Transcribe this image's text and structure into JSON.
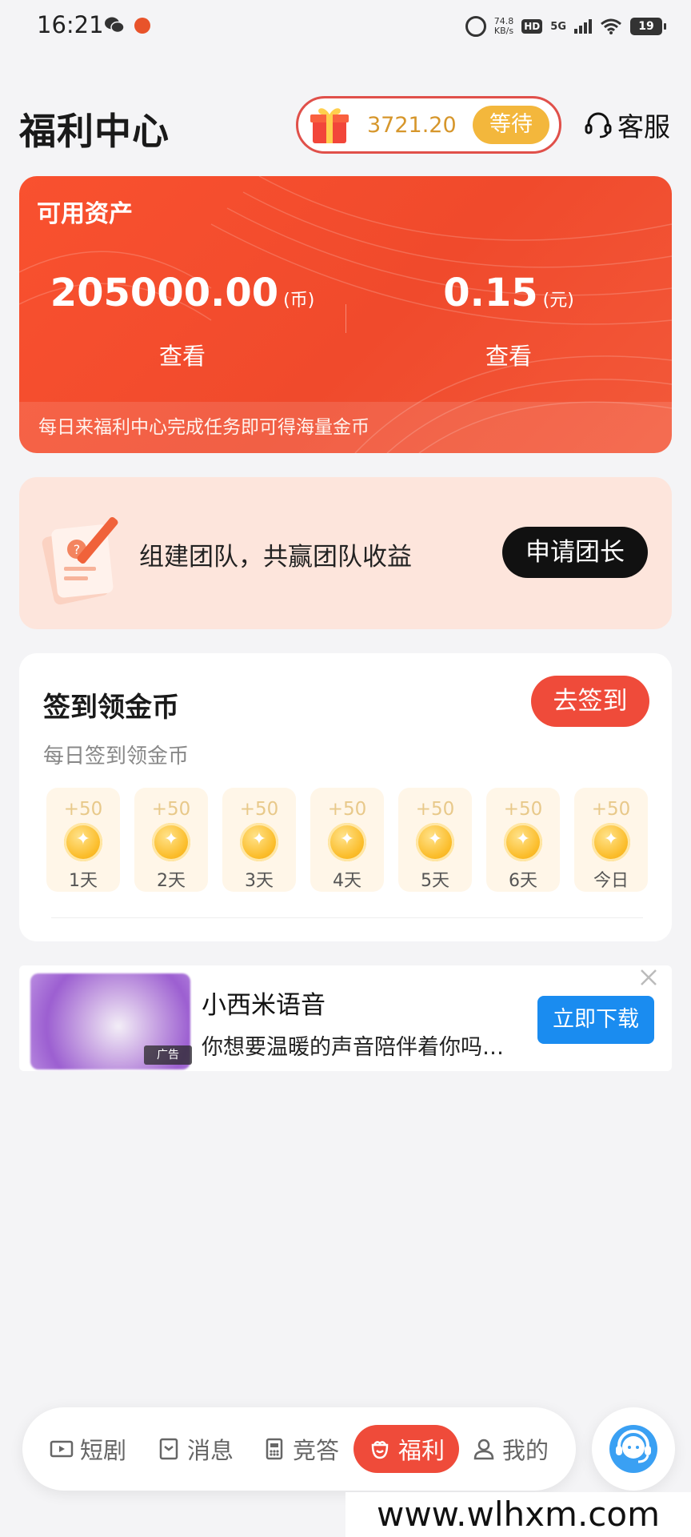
{
  "status_bar": {
    "time": "16:21",
    "net_speed": "74.8",
    "net_speed_unit": "KB/s",
    "hd": "HD",
    "network": "5G",
    "battery": "19",
    "icons": [
      "wechat-icon",
      "app-icon",
      "alarm-icon",
      "signal-icon",
      "wifi-icon",
      "battery-icon"
    ]
  },
  "header": {
    "title": "福利中心",
    "coin_value": "3721.20",
    "wait_label": "等待",
    "service_label": "客服"
  },
  "assets": {
    "title": "可用资产",
    "coins": {
      "amount": "205000.00",
      "unit": "(币)",
      "view_label": "查看"
    },
    "cash": {
      "amount": "0.15",
      "unit": "(元)",
      "view_label": "查看"
    },
    "footer": "每日来福利中心完成任务即可得海量金币"
  },
  "team": {
    "text": "组建团队，共赢团队收益",
    "button_label": "申请团长"
  },
  "checkin": {
    "title": "签到领金币",
    "button_label": "去签到",
    "subtitle": "每日签到领金币",
    "days": [
      {
        "reward": "+50",
        "label": "1天"
      },
      {
        "reward": "+50",
        "label": "2天"
      },
      {
        "reward": "+50",
        "label": "3天"
      },
      {
        "reward": "+50",
        "label": "4天"
      },
      {
        "reward": "+50",
        "label": "5天"
      },
      {
        "reward": "+50",
        "label": "6天"
      },
      {
        "reward": "+50",
        "label": "今日"
      }
    ]
  },
  "ad": {
    "title": "小西米语音",
    "description": "你想要温暖的声音陪伴着你吗…",
    "badge": "广告",
    "button_label": "立即下载"
  },
  "nav": {
    "items": [
      {
        "label": "短剧",
        "icon": "video-icon"
      },
      {
        "label": "消息",
        "icon": "message-icon"
      },
      {
        "label": "竞答",
        "icon": "quiz-icon"
      },
      {
        "label": "福利",
        "icon": "gift-bag-icon"
      },
      {
        "label": "我的",
        "icon": "user-icon"
      }
    ],
    "active": "福利"
  },
  "watermark": "www.wlhxm.com",
  "colors": {
    "primary_red": "#ef4b3a",
    "card_red": "#f9512f",
    "gold": "#f3b73c",
    "team_bg": "#fde5dc",
    "ad_blue": "#1a8cf0"
  }
}
